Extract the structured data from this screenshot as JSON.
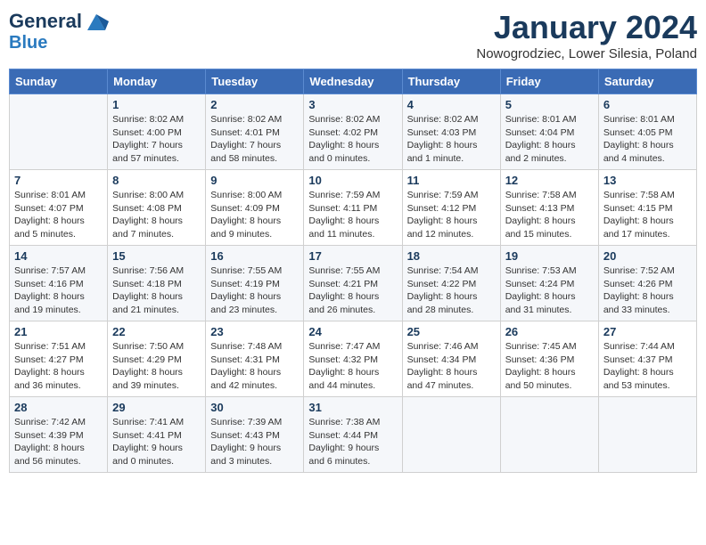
{
  "header": {
    "logo_line1": "General",
    "logo_line2": "Blue",
    "month": "January 2024",
    "location": "Nowogrodziec, Lower Silesia, Poland"
  },
  "days_of_week": [
    "Sunday",
    "Monday",
    "Tuesday",
    "Wednesday",
    "Thursday",
    "Friday",
    "Saturday"
  ],
  "weeks": [
    [
      {
        "day": "",
        "sunrise": "",
        "sunset": "",
        "daylight": ""
      },
      {
        "day": "1",
        "sunrise": "8:02 AM",
        "sunset": "4:00 PM",
        "daylight": "7 hours and 57 minutes."
      },
      {
        "day": "2",
        "sunrise": "8:02 AM",
        "sunset": "4:01 PM",
        "daylight": "7 hours and 58 minutes."
      },
      {
        "day": "3",
        "sunrise": "8:02 AM",
        "sunset": "4:02 PM",
        "daylight": "8 hours and 0 minutes."
      },
      {
        "day": "4",
        "sunrise": "8:02 AM",
        "sunset": "4:03 PM",
        "daylight": "8 hours and 1 minute."
      },
      {
        "day": "5",
        "sunrise": "8:01 AM",
        "sunset": "4:04 PM",
        "daylight": "8 hours and 2 minutes."
      },
      {
        "day": "6",
        "sunrise": "8:01 AM",
        "sunset": "4:05 PM",
        "daylight": "8 hours and 4 minutes."
      }
    ],
    [
      {
        "day": "7",
        "sunrise": "8:01 AM",
        "sunset": "4:07 PM",
        "daylight": "8 hours and 5 minutes."
      },
      {
        "day": "8",
        "sunrise": "8:00 AM",
        "sunset": "4:08 PM",
        "daylight": "8 hours and 7 minutes."
      },
      {
        "day": "9",
        "sunrise": "8:00 AM",
        "sunset": "4:09 PM",
        "daylight": "8 hours and 9 minutes."
      },
      {
        "day": "10",
        "sunrise": "7:59 AM",
        "sunset": "4:11 PM",
        "daylight": "8 hours and 11 minutes."
      },
      {
        "day": "11",
        "sunrise": "7:59 AM",
        "sunset": "4:12 PM",
        "daylight": "8 hours and 12 minutes."
      },
      {
        "day": "12",
        "sunrise": "7:58 AM",
        "sunset": "4:13 PM",
        "daylight": "8 hours and 15 minutes."
      },
      {
        "day": "13",
        "sunrise": "7:58 AM",
        "sunset": "4:15 PM",
        "daylight": "8 hours and 17 minutes."
      }
    ],
    [
      {
        "day": "14",
        "sunrise": "7:57 AM",
        "sunset": "4:16 PM",
        "daylight": "8 hours and 19 minutes."
      },
      {
        "day": "15",
        "sunrise": "7:56 AM",
        "sunset": "4:18 PM",
        "daylight": "8 hours and 21 minutes."
      },
      {
        "day": "16",
        "sunrise": "7:55 AM",
        "sunset": "4:19 PM",
        "daylight": "8 hours and 23 minutes."
      },
      {
        "day": "17",
        "sunrise": "7:55 AM",
        "sunset": "4:21 PM",
        "daylight": "8 hours and 26 minutes."
      },
      {
        "day": "18",
        "sunrise": "7:54 AM",
        "sunset": "4:22 PM",
        "daylight": "8 hours and 28 minutes."
      },
      {
        "day": "19",
        "sunrise": "7:53 AM",
        "sunset": "4:24 PM",
        "daylight": "8 hours and 31 minutes."
      },
      {
        "day": "20",
        "sunrise": "7:52 AM",
        "sunset": "4:26 PM",
        "daylight": "8 hours and 33 minutes."
      }
    ],
    [
      {
        "day": "21",
        "sunrise": "7:51 AM",
        "sunset": "4:27 PM",
        "daylight": "8 hours and 36 minutes."
      },
      {
        "day": "22",
        "sunrise": "7:50 AM",
        "sunset": "4:29 PM",
        "daylight": "8 hours and 39 minutes."
      },
      {
        "day": "23",
        "sunrise": "7:48 AM",
        "sunset": "4:31 PM",
        "daylight": "8 hours and 42 minutes."
      },
      {
        "day": "24",
        "sunrise": "7:47 AM",
        "sunset": "4:32 PM",
        "daylight": "8 hours and 44 minutes."
      },
      {
        "day": "25",
        "sunrise": "7:46 AM",
        "sunset": "4:34 PM",
        "daylight": "8 hours and 47 minutes."
      },
      {
        "day": "26",
        "sunrise": "7:45 AM",
        "sunset": "4:36 PM",
        "daylight": "8 hours and 50 minutes."
      },
      {
        "day": "27",
        "sunrise": "7:44 AM",
        "sunset": "4:37 PM",
        "daylight": "8 hours and 53 minutes."
      }
    ],
    [
      {
        "day": "28",
        "sunrise": "7:42 AM",
        "sunset": "4:39 PM",
        "daylight": "8 hours and 56 minutes."
      },
      {
        "day": "29",
        "sunrise": "7:41 AM",
        "sunset": "4:41 PM",
        "daylight": "9 hours and 0 minutes."
      },
      {
        "day": "30",
        "sunrise": "7:39 AM",
        "sunset": "4:43 PM",
        "daylight": "9 hours and 3 minutes."
      },
      {
        "day": "31",
        "sunrise": "7:38 AM",
        "sunset": "4:44 PM",
        "daylight": "9 hours and 6 minutes."
      },
      {
        "day": "",
        "sunrise": "",
        "sunset": "",
        "daylight": ""
      },
      {
        "day": "",
        "sunrise": "",
        "sunset": "",
        "daylight": ""
      },
      {
        "day": "",
        "sunrise": "",
        "sunset": "",
        "daylight": ""
      }
    ]
  ],
  "labels": {
    "sunrise_prefix": "Sunrise: ",
    "sunset_prefix": "Sunset: ",
    "daylight_prefix": "Daylight: "
  }
}
